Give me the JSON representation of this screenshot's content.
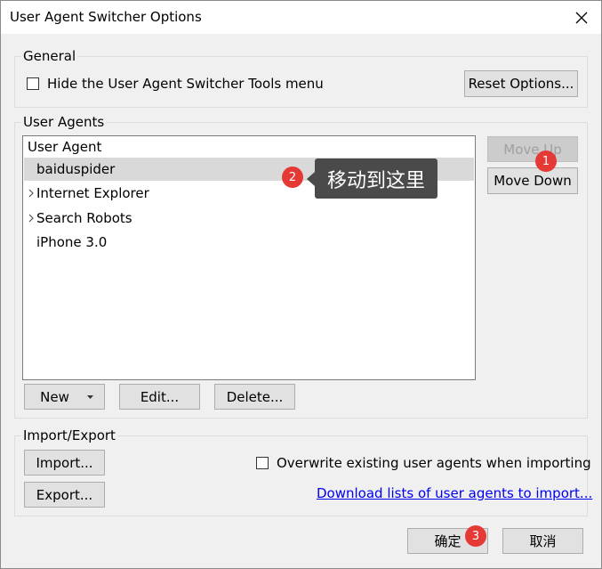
{
  "window": {
    "title": "User Agent Switcher Options"
  },
  "general": {
    "group_label": "General",
    "hide_menu_label": "Hide the User Agent Switcher Tools menu",
    "hide_menu_checked": false,
    "reset_label": "Reset Options..."
  },
  "user_agents": {
    "group_label": "User Agents",
    "column_header": "User Agent",
    "items": [
      {
        "label": "baiduspider",
        "selected": true,
        "expandable": false
      },
      {
        "label": "Internet Explorer",
        "selected": false,
        "expandable": true
      },
      {
        "label": "Search Robots",
        "selected": false,
        "expandable": true
      },
      {
        "label": "iPhone 3.0",
        "selected": false,
        "expandable": false
      }
    ],
    "move_up_label": "Move Up",
    "move_down_label": "Move Down",
    "new_label": "New",
    "edit_label": "Edit...",
    "delete_label": "Delete..."
  },
  "import_export": {
    "group_label": "Import/Export",
    "import_label": "Import...",
    "export_label": "Export...",
    "overwrite_label": "Overwrite existing user agents when importing",
    "overwrite_checked": false,
    "download_link": "Download lists of user agents to import..."
  },
  "dialog": {
    "ok_label": "确定",
    "cancel_label": "取消"
  },
  "annotations": {
    "marker1": "1",
    "marker2": "2",
    "marker3": "3",
    "tooltip": "移动到这里"
  },
  "colors": {
    "marker": "#e53935",
    "tooltip_bg": "#4a4a4a",
    "selected_row": "#d9d9d9",
    "link": "#0000ee"
  }
}
